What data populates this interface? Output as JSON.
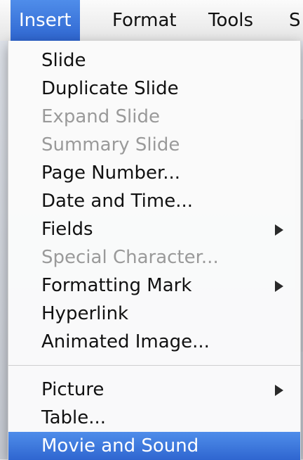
{
  "menubar": {
    "items": [
      {
        "label": "Insert",
        "active": true
      },
      {
        "label": "Format",
        "active": false
      },
      {
        "label": "Tools",
        "active": false
      },
      {
        "label": "S",
        "active": false
      }
    ]
  },
  "insert_menu": {
    "groups": [
      {
        "items": [
          {
            "label": "Slide",
            "enabled": true
          },
          {
            "label": "Duplicate Slide",
            "enabled": true
          },
          {
            "label": "Expand Slide",
            "enabled": false
          },
          {
            "label": "Summary Slide",
            "enabled": false
          },
          {
            "label": "Page Number...",
            "enabled": true
          },
          {
            "label": "Date and Time...",
            "enabled": true
          },
          {
            "label": "Fields",
            "enabled": true,
            "submenu": true
          },
          {
            "label": "Special Character...",
            "enabled": false
          },
          {
            "label": "Formatting Mark",
            "enabled": true,
            "submenu": true
          },
          {
            "label": "Hyperlink",
            "enabled": true
          },
          {
            "label": "Animated Image...",
            "enabled": true
          }
        ]
      },
      {
        "items": [
          {
            "label": "Picture",
            "enabled": true,
            "submenu": true
          },
          {
            "label": "Table...",
            "enabled": true
          },
          {
            "label": "Movie and Sound",
            "enabled": true,
            "highlighted": true
          }
        ]
      }
    ]
  },
  "colors": {
    "highlight": "#3a74dc",
    "disabled_text": "#9a9a9a",
    "menu_bg": "#fafafa"
  }
}
